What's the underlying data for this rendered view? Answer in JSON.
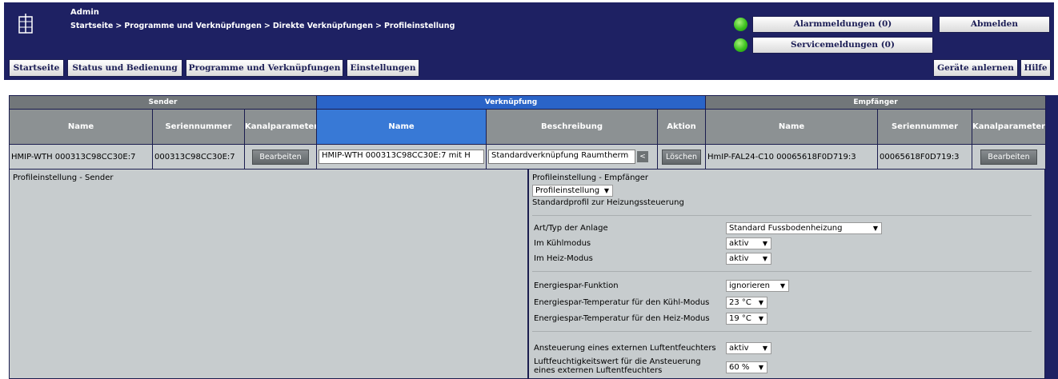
{
  "header": {
    "admin": "Admin",
    "breadcrumb": [
      "Startseite",
      "Programme und Verknüpfungen",
      "Direkte Verknüpfungen",
      "Profileinstellung"
    ],
    "breadcrumb_sep": ">",
    "alarm_label": "Alarmmeldungen (0)",
    "service_label": "Servicemeldungen (0)",
    "logout_label": "Abmelden",
    "teach_label": "Geräte anlernen",
    "help_label": "Hilfe",
    "nav": [
      "Startseite",
      "Status und Bedienung",
      "Programme und Verknüpfungen",
      "Einstellungen"
    ]
  },
  "table": {
    "groups": {
      "sender": "Sender",
      "link": "Verknüpfung",
      "receiver": "Empfänger"
    },
    "columns": {
      "sender_name": "Name",
      "sender_serial": "Seriennummer",
      "sender_params": "Kanalparameter",
      "link_name": "Name",
      "link_desc": "Beschreibung",
      "link_action": "Aktion",
      "recv_name": "Name",
      "recv_serial": "Seriennummer",
      "recv_params": "Kanalparameter"
    },
    "row": {
      "sender_name": "HMIP-WTH 000313C98CC30E:7",
      "sender_serial": "000313C98CC30E:7",
      "sender_edit": "Bearbeiten",
      "link_name": "HMIP-WTH 000313C98CC30E:7 mit H",
      "link_desc": "Standardverknüpfung Raumtherm",
      "link_arrow": "<",
      "delete": "Löschen",
      "recv_name": "HmIP-FAL24-C10 00065618F0D719:3",
      "recv_serial": "00065618F0D719:3",
      "recv_edit": "Bearbeiten"
    }
  },
  "profile": {
    "sender_title": "Profileinstellung - Sender",
    "receiver_title": "Profileinstellung - Empfänger",
    "profile_select": "Profileinstellung",
    "profile_desc": "Standardprofil zur Heizungssteuerung",
    "settings": [
      {
        "label": "Art/Typ der Anlage",
        "value": "Standard Fussbodenheizung"
      },
      {
        "label": "Im Kühlmodus",
        "value": "aktiv"
      },
      {
        "label": "Im Heiz-Modus",
        "value": "aktiv"
      },
      {
        "label": "Energiespar-Funktion",
        "value": "ignorieren"
      },
      {
        "label": "Energiespar-Temperatur für den Kühl-Modus",
        "value": "23 °C"
      },
      {
        "label": "Energiespar-Temperatur für den Heiz-Modus",
        "value": "19 °C"
      },
      {
        "label": "Ansteuerung eines externen Luftentfeuchters",
        "value": "aktiv"
      },
      {
        "label": "Luftfeuchtigkeitswert für die Ansteuerung",
        "label2": "eines externen Luftentfeuchters",
        "value": "60 %"
      }
    ]
  },
  "icons": {
    "logo": "house-logo-icon",
    "status_led": "green-led-icon",
    "dropdown": "caret-down-icon"
  },
  "colors": {
    "header_bg": "#1e2163",
    "group_gray": "#72777a",
    "group_blue": "#2a64c8",
    "panel_bg": "#c7ccce",
    "led": "#3bc11e"
  }
}
